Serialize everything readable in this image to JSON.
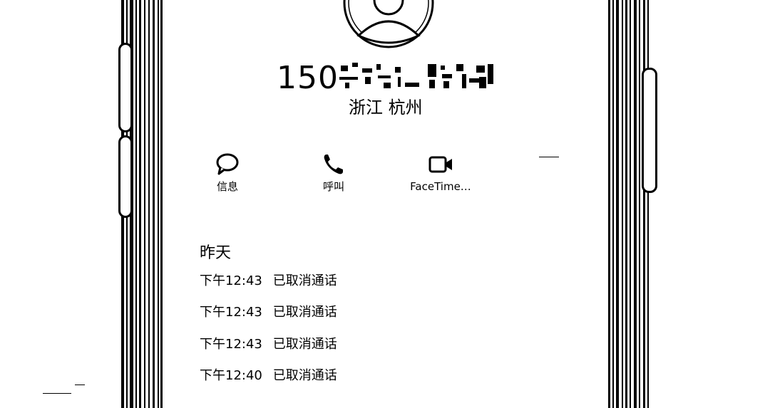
{
  "contact": {
    "number_visible": "150",
    "location": "浙江 杭州"
  },
  "actions": [
    {
      "label": "信息",
      "icon": "message-bubble-icon"
    },
    {
      "label": "呼叫",
      "icon": "phone-icon"
    },
    {
      "label": "FaceTime…",
      "icon": "video-camera-icon"
    }
  ],
  "history": {
    "date": "昨天",
    "rows": [
      {
        "time": "下午12:43",
        "status": "已取消通话"
      },
      {
        "time": "下午12:43",
        "status": "已取消通话"
      },
      {
        "time": "下午12:43",
        "status": "已取消通话"
      },
      {
        "time": "下午12:40",
        "status": "已取消通话"
      }
    ]
  }
}
